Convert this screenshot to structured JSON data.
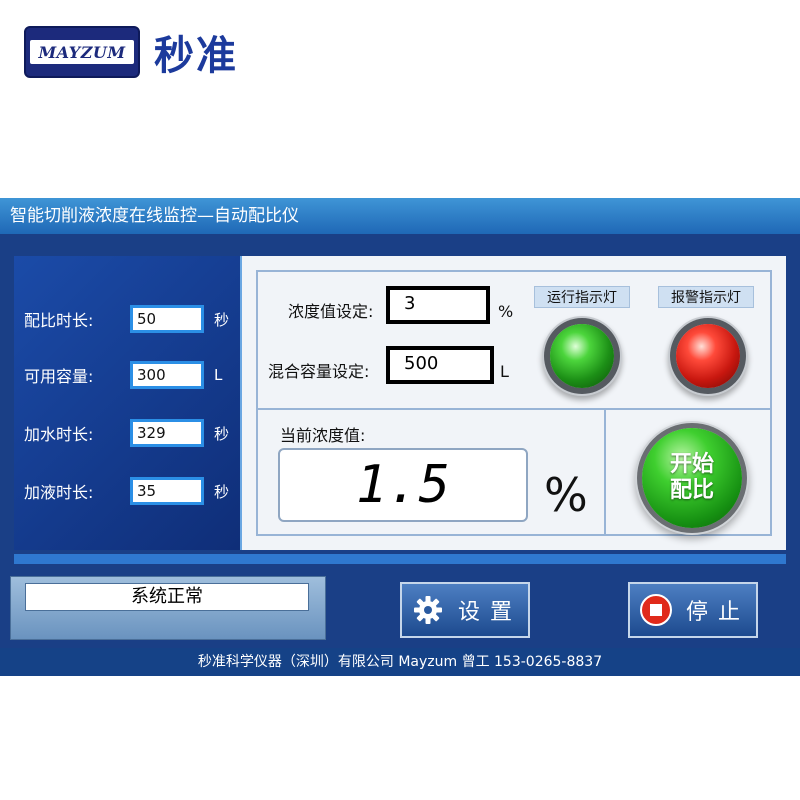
{
  "brand": {
    "badge_text": "MAYZUM",
    "name_cn": "秒准"
  },
  "app": {
    "title": "智能切削液浓度在线监控—自动配比仪"
  },
  "params": [
    {
      "label": "配比时长:",
      "value": "50",
      "unit": "秒"
    },
    {
      "label": "可用容量:",
      "value": "300",
      "unit": "L"
    },
    {
      "label": "加水时长:",
      "value": "329",
      "unit": "秒"
    },
    {
      "label": "加液时长:",
      "value": "35",
      "unit": "秒"
    }
  ],
  "settings": {
    "concentration": {
      "label": "浓度值设定:",
      "value": "3",
      "unit": "%"
    },
    "capacity": {
      "label": "混合容量设定:",
      "value": "500",
      "unit": "L"
    }
  },
  "indicators": {
    "run": {
      "label": "运行指示灯",
      "color": "#2fbf22"
    },
    "alarm": {
      "label": "报警指示灯",
      "color": "#e0261a"
    }
  },
  "current": {
    "label": "当前浓度值:",
    "value": "1.5",
    "unit": "%"
  },
  "start_button": {
    "line1": "开始",
    "line2": "配比"
  },
  "status": {
    "text": "系统正常"
  },
  "buttons": {
    "settings": "设置",
    "stop": "停止"
  },
  "footer": {
    "text": "秒准科学仪器（深圳）有限公司 Mayzum 曾工 153-0265-8837"
  }
}
